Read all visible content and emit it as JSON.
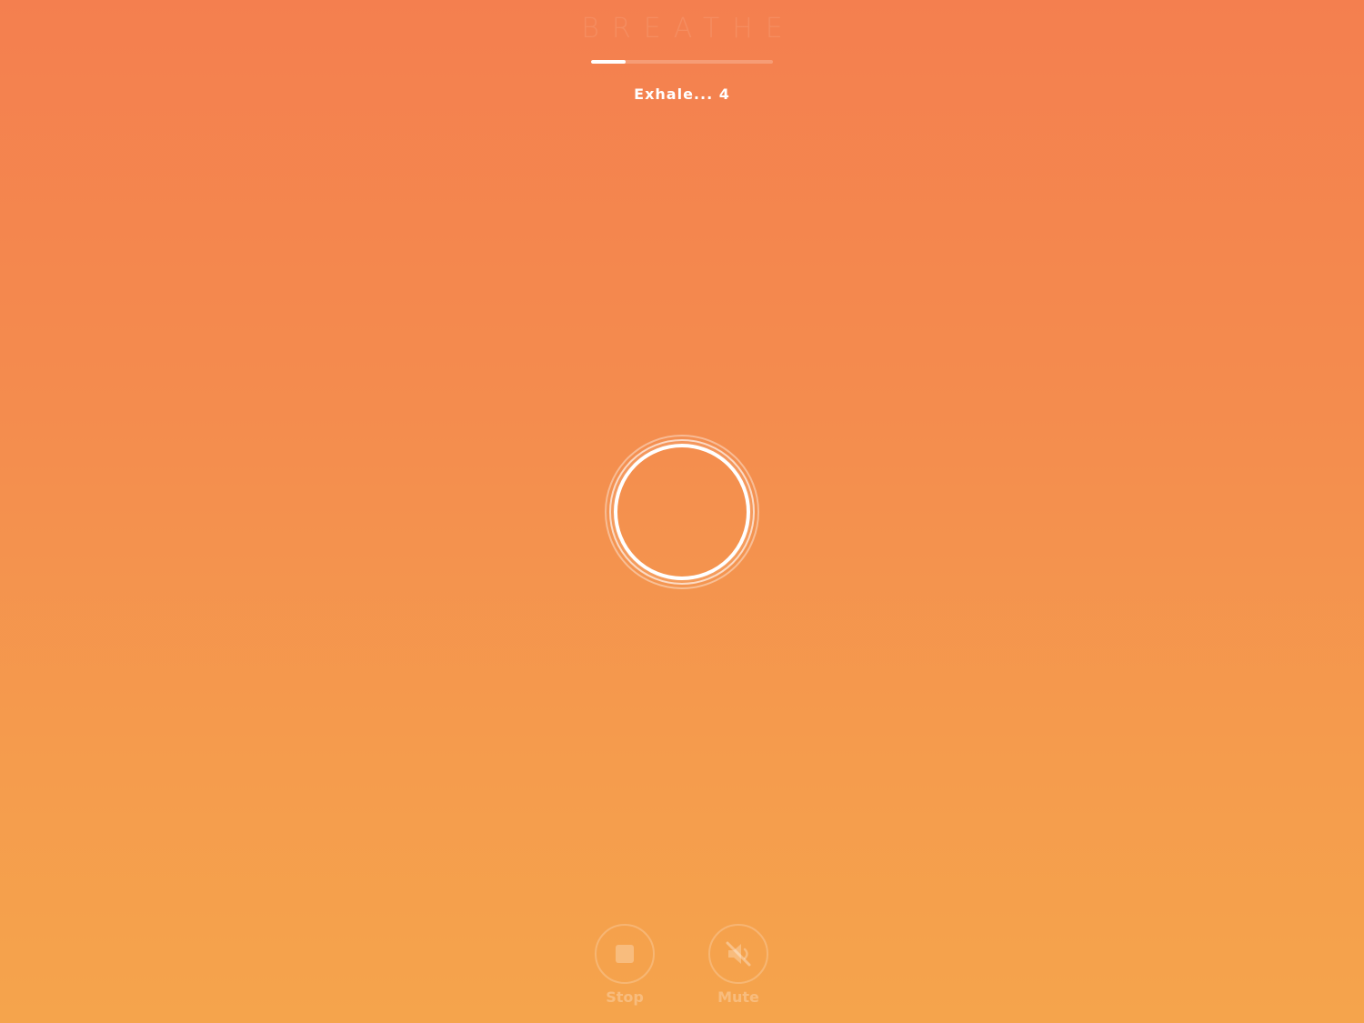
{
  "app": {
    "title": "BREATHE"
  },
  "session": {
    "progress_fraction": 0.19,
    "phase_text": "Exhale... 4"
  },
  "controls": {
    "stop": {
      "label": "Stop",
      "icon": "stop-icon"
    },
    "mute": {
      "label": "Mute",
      "icon": "speaker-muted-icon"
    }
  },
  "colors": {
    "gradient_top": "#f47f4f",
    "gradient_bottom": "#f5a44c",
    "foreground": "#ffffff"
  }
}
